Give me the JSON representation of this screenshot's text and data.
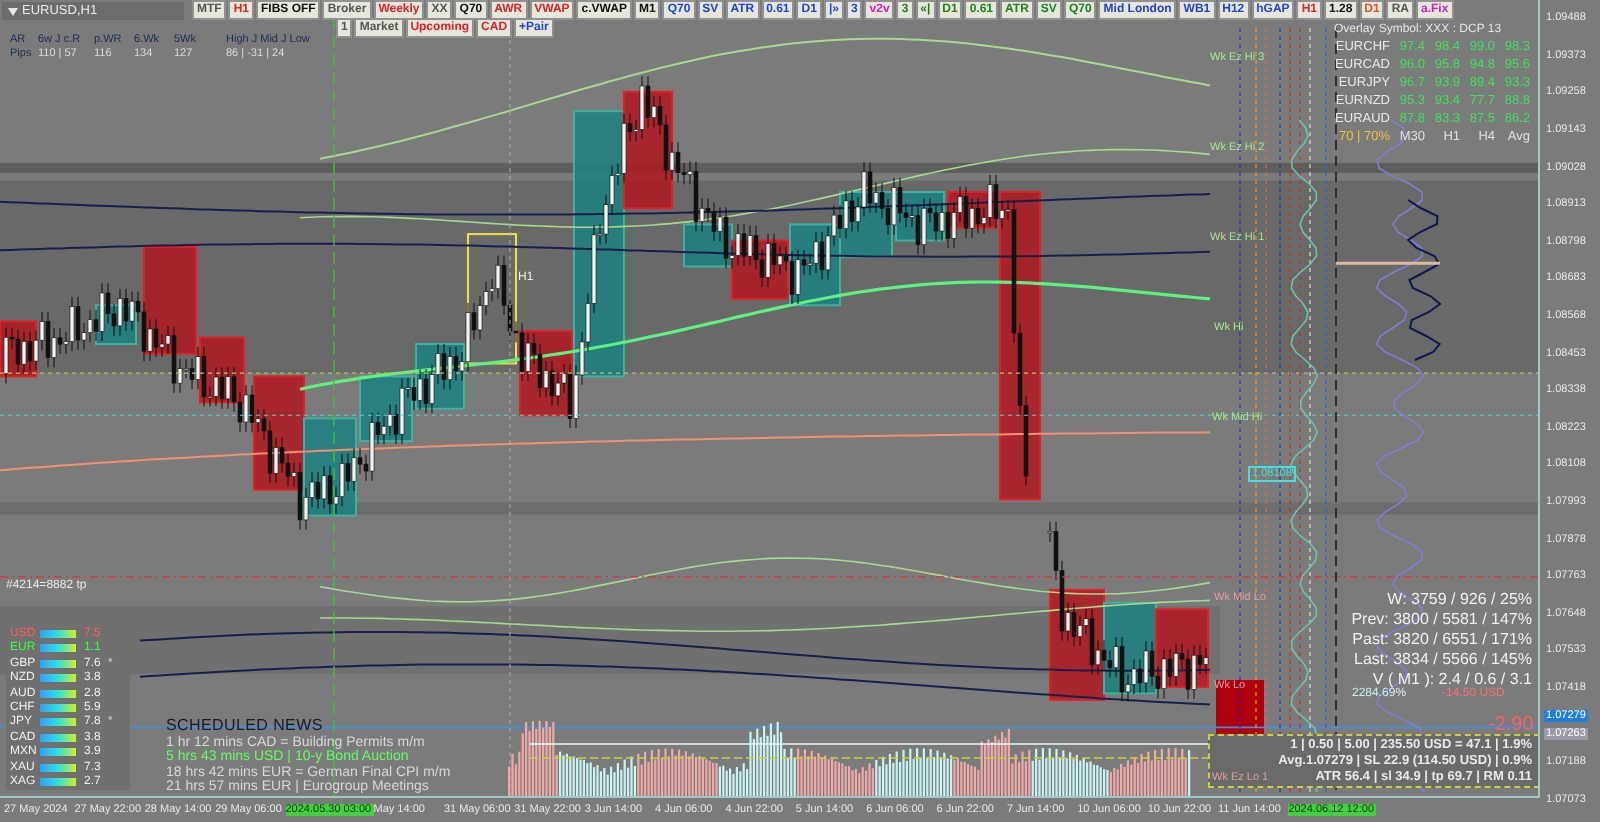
{
  "chart": {
    "symbol": "EURUSD,H1",
    "order_label": "#4214=8882 tp",
    "candle_label": "H1"
  },
  "toolbar_row_1": [
    {
      "label": "MTF",
      "color": "#555555"
    },
    {
      "label": "H1",
      "color": "#e0202a"
    },
    {
      "label": "FIBS OFF",
      "color": "#111111"
    },
    {
      "label": "Broker",
      "color": "#555555"
    },
    {
      "label": "Weekly",
      "color": "#e0202a"
    },
    {
      "label": "XX",
      "color": "#555555"
    },
    {
      "label": "Q70",
      "color": "#111111"
    },
    {
      "label": "AWR",
      "color": "#e0202a"
    },
    {
      "label": "VWAP",
      "color": "#e0202a"
    },
    {
      "label": "c.VWAP",
      "color": "#111111"
    },
    {
      "label": "M1",
      "color": "#111111"
    },
    {
      "label": "Q70",
      "color": "#2040e0"
    },
    {
      "label": "SV",
      "color": "#2040e0"
    },
    {
      "label": "ATR",
      "color": "#2040e0"
    },
    {
      "label": "0.61",
      "color": "#2040e0"
    },
    {
      "label": "D1",
      "color": "#2040e0"
    },
    {
      "label": "|»",
      "color": "#2040e0"
    },
    {
      "label": "3",
      "color": "#2040e0"
    },
    {
      "label": "v2v",
      "color": "#d020c0"
    },
    {
      "label": "3",
      "color": "#208020"
    },
    {
      "label": "«|",
      "color": "#208020"
    },
    {
      "label": "D1",
      "color": "#208020"
    },
    {
      "label": "0.61",
      "color": "#208020"
    },
    {
      "label": "ATR",
      "color": "#208020"
    },
    {
      "label": "SV",
      "color": "#208020"
    },
    {
      "label": "Q70",
      "color": "#208020"
    },
    {
      "label": "Mid London",
      "color": "#2040e0"
    },
    {
      "label": "WB1",
      "color": "#2040e0"
    },
    {
      "label": "H12",
      "color": "#2040e0"
    },
    {
      "label": "hGAP",
      "color": "#2040e0"
    },
    {
      "label": "H1",
      "color": "#e0202a"
    },
    {
      "label": "1.28",
      "color": "#111111"
    },
    {
      "label": "D1",
      "color": "#e05020"
    },
    {
      "label": "RA",
      "color": "#555555"
    },
    {
      "label": "a.Fix",
      "color": "#d020c0"
    }
  ],
  "toolbar_row_2": [
    {
      "label": "1",
      "color": "#555555"
    },
    {
      "label": "Market",
      "color": "#555555"
    },
    {
      "label": "Upcoming",
      "color": "#e0202a"
    },
    {
      "label": "CAD",
      "color": "#e0202a"
    },
    {
      "label": "+Pair",
      "color": "#2040e0"
    }
  ],
  "range_panel": {
    "headers": [
      "AR",
      "6w J c.R",
      "p.WR",
      "6.Wk",
      "5Wk",
      "High J Mid J Low"
    ],
    "values": [
      "Pips",
      "110 | 57",
      "116",
      "134",
      "127",
      "86 | -31 | 24"
    ]
  },
  "overlay_table": {
    "title": "Overlay Symbol: XXX : DCP 13",
    "rows": [
      {
        "pair": "EURCHF",
        "values": [
          "97.4",
          "98.4",
          "99.0",
          "98.3"
        ]
      },
      {
        "pair": "EURCAD",
        "values": [
          "96.0",
          "95.8",
          "94.8",
          "95.6"
        ]
      },
      {
        "pair": "EURJPY",
        "values": [
          "96.7",
          "93.9",
          "89.4",
          "93.3"
        ]
      },
      {
        "pair": "EURNZD",
        "values": [
          "95.3",
          "93.4",
          "77.7",
          "88.8"
        ]
      },
      {
        "pair": "EURAUD",
        "values": [
          "87.8",
          "83.3",
          "87.5",
          "86.2"
        ]
      }
    ],
    "quality": "70 | 70%",
    "columns": [
      "M30",
      "H1",
      "H4",
      "Avg"
    ]
  },
  "levels": [
    {
      "label": "Wk Ez Hi 3",
      "kind": "level"
    },
    {
      "label": "Wk Ez Hi 2",
      "kind": "level"
    },
    {
      "label": "Wk Ez Hi 1",
      "kind": "level"
    },
    {
      "label": "Wk Hi",
      "kind": "level"
    },
    {
      "label": "Wk Mid Hi",
      "kind": "level"
    },
    {
      "label": "1.08108",
      "kind": "price"
    },
    {
      "label": "Wk Mid Lo",
      "kind": "low"
    },
    {
      "label": "Wk Lo",
      "kind": "low"
    },
    {
      "label": "Wk Ez Lo 1",
      "kind": "low"
    }
  ],
  "currency_strength": [
    {
      "code": "USD",
      "value": "7.5",
      "color": "#ff6060"
    },
    {
      "code": "EUR",
      "value": "1.1",
      "color": "#40ff40"
    },
    {
      "code": "GBP",
      "value": "7.6",
      "note": "*",
      "color": "#f0f0f0"
    },
    {
      "code": "NZD",
      "value": "3.8",
      "color": "#f0f0f0"
    },
    {
      "code": "AUD",
      "value": "2.8",
      "color": "#f0f0f0"
    },
    {
      "code": "CHF",
      "value": "5.9",
      "color": "#f0f0f0"
    },
    {
      "code": "JPY",
      "value": "7.8",
      "note": "*",
      "color": "#f0f0f0"
    },
    {
      "code": "CAD",
      "value": "3.8",
      "color": "#f0f0f0"
    },
    {
      "code": "MXN",
      "value": "3.9",
      "color": "#f0f0f0"
    },
    {
      "code": "XAU",
      "value": "7.3",
      "color": "#f0f0f0"
    },
    {
      "code": "XAG",
      "value": "2.7",
      "color": "#f0f0f0"
    }
  ],
  "news": {
    "title": "SCHEDULED NEWS",
    "items": [
      {
        "text": "1 hr 12 mins  CAD  =  Building Permits m/m",
        "highlighted": false
      },
      {
        "text": "5 hrs 43 mins  USD  |  10-y Bond Auction",
        "highlighted": true
      },
      {
        "text": "18 hrs 42 mins  EUR  =  German Final CPI m/m",
        "highlighted": false
      },
      {
        "text": "21 hrs 57 mins  EUR  |  Eurogroup Meetings",
        "highlighted": false
      }
    ]
  },
  "stats": [
    "W: 3759 / 926 / 25%",
    "Prev: 3800 / 5581 / 147%",
    "Past: 3820 / 6551 / 171%",
    "Last: 3834 / 5566 / 145%",
    "V ( M1 ): 2.4 / 0.6 / 3.1"
  ],
  "result": {
    "percent": "2284.69%",
    "profit": "-14.50 USD",
    "pips": "-2.90"
  },
  "trade_panel": [
    "1  |  0.50  |  5.00  |  235.50 USD = 47.1  |  1.9%",
    "Avg.1.07279  |  SL 22.9 (114.50 USD)  |  0.9%",
    "ATR 56.4  |  sl 34.9  |  tp 69.7  |  RM 0.11"
  ],
  "price_axis": [
    {
      "label": "1.09488",
      "kind": "tick"
    },
    {
      "label": "1.09373",
      "kind": "tick"
    },
    {
      "label": "1.09258",
      "kind": "tick"
    },
    {
      "label": "1.09143",
      "kind": "tick"
    },
    {
      "label": "1.09028",
      "kind": "tick"
    },
    {
      "label": "1.08913",
      "kind": "tick"
    },
    {
      "label": "1.08798",
      "kind": "tick"
    },
    {
      "label": "1.08683",
      "kind": "tick"
    },
    {
      "label": "1.08568",
      "kind": "tick"
    },
    {
      "label": "1.08453",
      "kind": "tick"
    },
    {
      "label": "1.08338",
      "kind": "tick"
    },
    {
      "label": "1.08223",
      "kind": "tick"
    },
    {
      "label": "1.08108",
      "kind": "tick"
    },
    {
      "label": "1.07993",
      "kind": "tick"
    },
    {
      "label": "1.07878",
      "kind": "tick"
    },
    {
      "label": "1.07763",
      "kind": "tick"
    },
    {
      "label": "1.07648",
      "kind": "tick"
    },
    {
      "label": "1.07533",
      "kind": "tick"
    },
    {
      "label": "1.07418",
      "kind": "tick"
    },
    {
      "label": "1.07279",
      "kind": "bid"
    },
    {
      "label": "1.07263",
      "kind": "ask"
    },
    {
      "label": "1.07188",
      "kind": "tick"
    },
    {
      "label": "1.07073",
      "kind": "tick"
    }
  ],
  "time_axis": [
    {
      "label": "27 May 2024",
      "kind": "tick"
    },
    {
      "label": "27 May 22:00",
      "kind": "tick"
    },
    {
      "label": "28 May 14:00",
      "kind": "tick"
    },
    {
      "label": "29 May 06:00",
      "kind": "tick"
    },
    {
      "label": "2024.05.30 03:00",
      "kind": "cursor"
    },
    {
      "label": "May 14:00",
      "kind": "tick"
    },
    {
      "label": "31 May 06:00",
      "kind": "tick"
    },
    {
      "label": "31 May 22:00",
      "kind": "tick"
    },
    {
      "label": "3 Jun 14:00",
      "kind": "tick"
    },
    {
      "label": "4 Jun 06:00",
      "kind": "tick"
    },
    {
      "label": "4 Jun 22:00",
      "kind": "tick"
    },
    {
      "label": "5 Jun 14:00",
      "kind": "tick"
    },
    {
      "label": "6 Jun 06:00",
      "kind": "tick"
    },
    {
      "label": "6 Jun 22:00",
      "kind": "tick"
    },
    {
      "label": "7 Jun 14:00",
      "kind": "tick"
    },
    {
      "label": "10 Jun 06:00",
      "kind": "tick"
    },
    {
      "label": "10 Jun 22:00",
      "kind": "tick"
    },
    {
      "label": "11 Jun 14:00",
      "kind": "tick"
    },
    {
      "label": "2024.06.12 12:00",
      "kind": "cursor"
    }
  ]
}
